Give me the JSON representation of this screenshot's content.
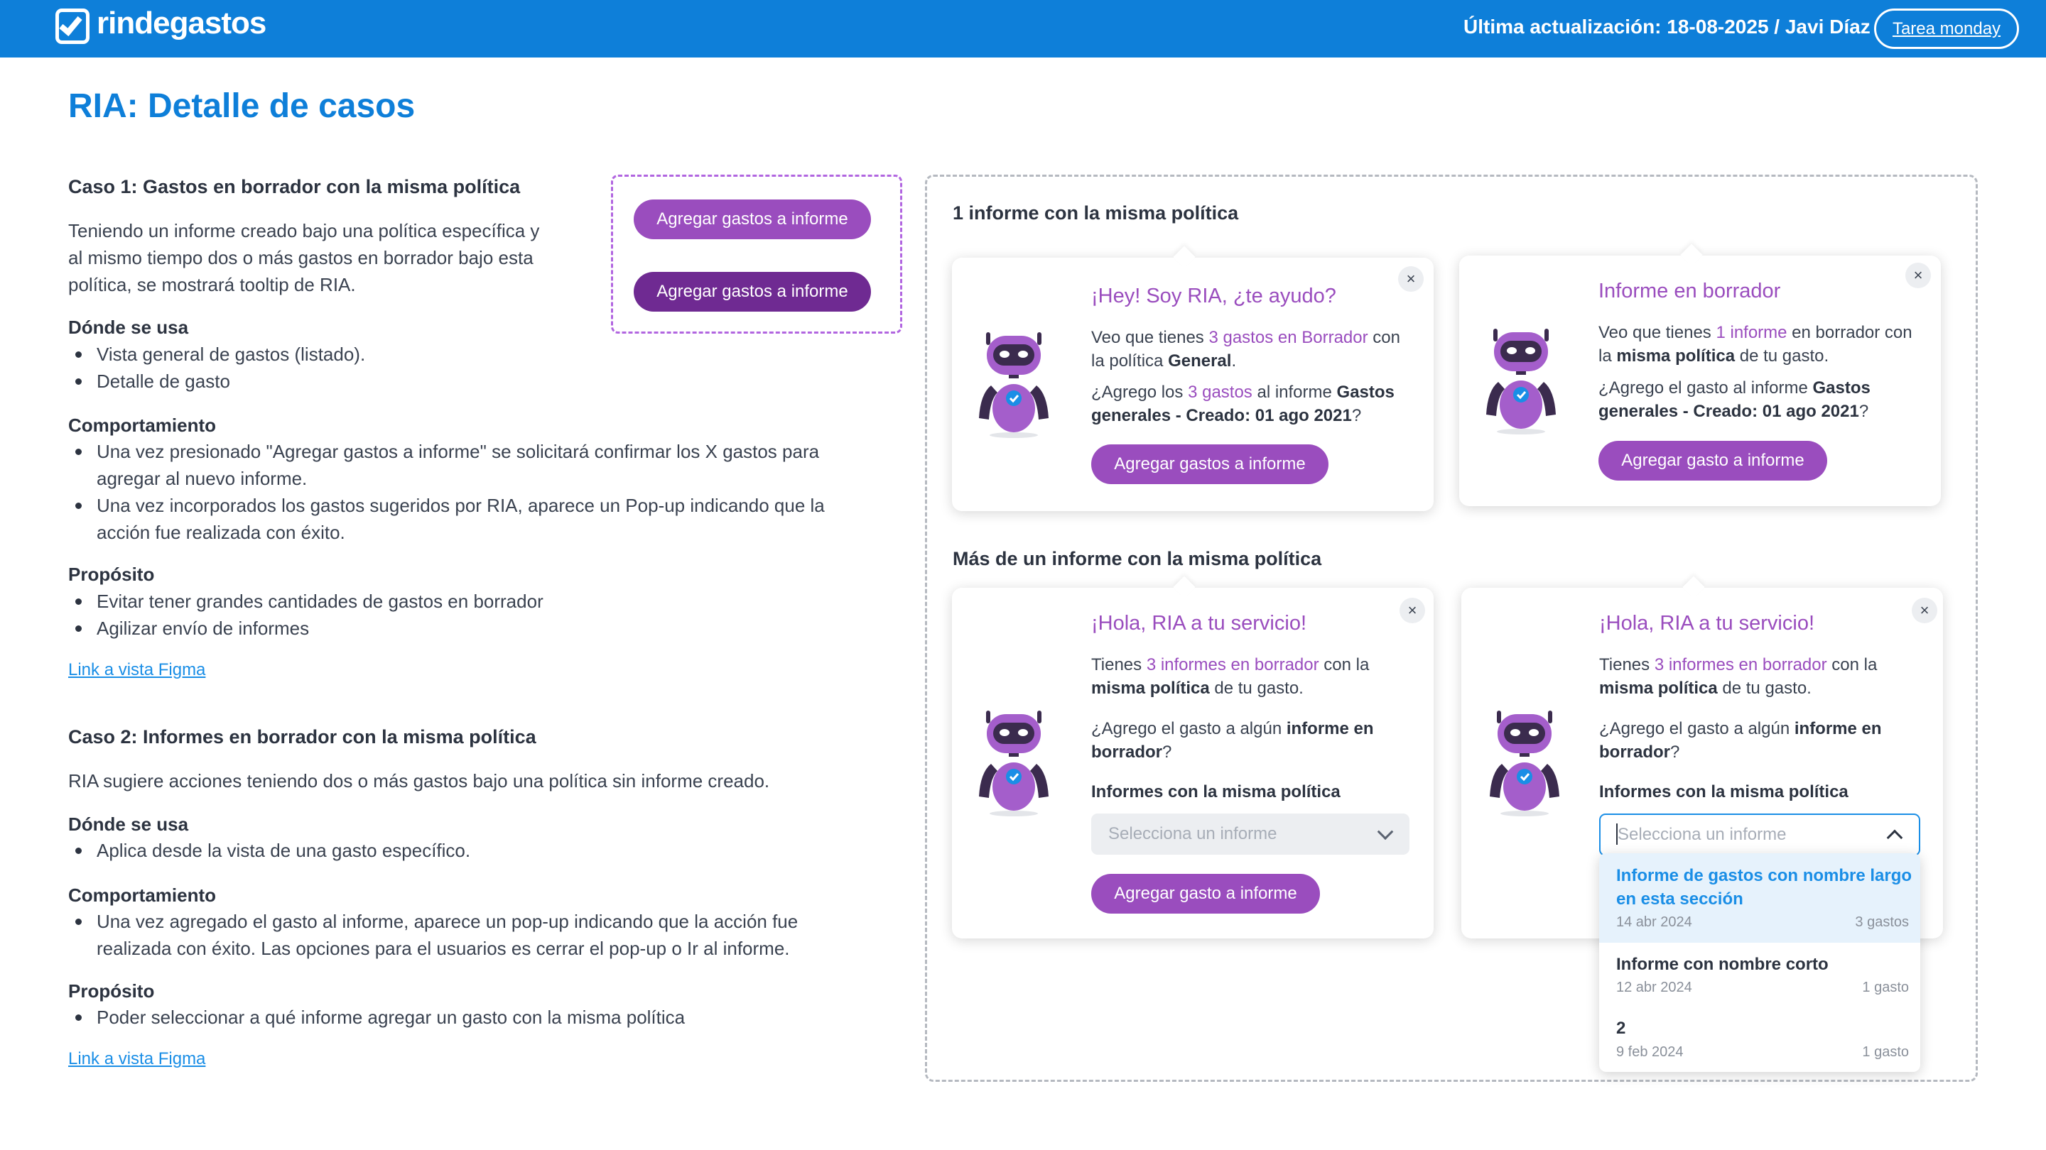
{
  "header": {
    "brand": "rindegastos",
    "updated": "Última actualización: 18-08-2025 / Javi Díaz",
    "tarea_button": "Tarea monday"
  },
  "page_title": "RIA: Detalle de casos",
  "case1": {
    "title": "Caso 1: Gastos en borrador con la misma política",
    "description": "Teniendo un informe creado bajo una política específica y al mismo tiempo dos o más gastos en borrador bajo esta política, se mostrará tooltip de RIA.",
    "donde_heading": "Dónde se usa",
    "donde_items": [
      "Vista general de gastos (listado).",
      "Detalle de gasto"
    ],
    "comportamiento_heading": "Comportamiento",
    "comportamiento_items": [
      "Una vez presionado \"Agregar gastos a informe\" se solicitará confirmar los X gastos para agregar al nuevo informe.",
      "Una vez incorporados los gastos sugeridos por RIA, aparece un Pop-up indicando que la acción fue realizada con éxito."
    ],
    "proposito_heading": "Propósito",
    "proposito_items": [
      "Evitar tener grandes cantidades de gastos en borrador",
      "Agilizar envío de informes"
    ],
    "link": "Link a vista Figma"
  },
  "case2": {
    "title": "Caso 2: Informes en borrador con la misma política",
    "description": "RIA sugiere acciones teniendo dos o más gastos bajo una política sin informe creado.",
    "donde_heading": "Dónde se usa",
    "donde_items": [
      "Aplica desde la vista de una gasto específico."
    ],
    "comportamiento_heading": "Comportamiento",
    "comportamiento_items": [
      "Una vez agregado el gasto al informe, aparece un pop-up indicando que la acción fue realizada con éxito. Las opciones para el usuarios es cerrar el pop-up o Ir al informe."
    ],
    "proposito_heading": "Propósito",
    "proposito_items": [
      "Poder seleccionar a qué informe agregar un gasto con la misma política"
    ],
    "link": "Link a vista Figma"
  },
  "button_demo": {
    "default_label": "Agregar gastos a informe",
    "hover_label": "Agregar gastos a informe"
  },
  "section1_title": "1 informe con la misma política",
  "section2_title": "Más de un informe con la misma política",
  "card1": {
    "title": "¡Hey! Soy RIA, ¿te ayudo?",
    "p1_a": "Veo que tienes ",
    "p1_hl": "3 gastos en Borrador",
    "p1_b": " con la política ",
    "p1_bold": "General",
    "p1_c": ".",
    "p2_a": "¿Agrego los ",
    "p2_hl": "3 gastos",
    "p2_b": " al informe ",
    "p2_bold": "Gastos generales - Creado: 01 ago 2021",
    "p2_c": "?",
    "button": "Agregar gastos a informe",
    "close": "×"
  },
  "card2": {
    "title": "Informe en borrador",
    "p1_a": "Veo que tienes ",
    "p1_hl": "1 informe",
    "p1_b": " en borrador con la ",
    "p1_bold": "misma política",
    "p1_c": " de tu gasto.",
    "p2_a": "¿Agrego el gasto al informe ",
    "p2_bold": "Gastos generales - Creado: 01 ago 2021",
    "p2_c": "?",
    "button": "Agregar gasto a informe",
    "close": "×"
  },
  "card3": {
    "title": "¡Hola, RIA a tu servicio!",
    "p1_a": "Tienes ",
    "p1_hl": "3 informes en borrador",
    "p1_b": " con la ",
    "p1_bold": "misma política",
    "p1_c": " de tu gasto.",
    "p2_a": "¿Agrego el gasto a algún ",
    "p2_bold": "informe en borrador",
    "p2_c": "?",
    "label": "Informes con la misma política",
    "select_placeholder": "Selecciona un informe",
    "button": "Agregar gasto a informe",
    "close": "×"
  },
  "card4": {
    "title": "¡Hola, RIA a tu servicio!",
    "p1_a": "Tienes ",
    "p1_hl": "3 informes en borrador",
    "p1_b": " con la ",
    "p1_bold": "misma política",
    "p1_c": " de tu gasto.",
    "p2_a": "¿Agrego el gasto a algún ",
    "p2_bold": "informe en borrador",
    "p2_c": "?",
    "label": "Informes con la misma política",
    "select_placeholder": "Selecciona un informe",
    "close": "×",
    "options": [
      {
        "name": "Informe de gastos con nombre largo en esta sección",
        "date": "14 abr 2024",
        "count": "3 gastos"
      },
      {
        "name": "Informe con nombre corto",
        "date": "12 abr 2024",
        "count": "1 gasto"
      },
      {
        "name": "2",
        "date": "9 feb 2024",
        "count": "1 gasto"
      }
    ]
  },
  "colors": {
    "brand_blue": "#0e7fd9",
    "ria_purple": "#9a4dbe",
    "ria_purple_dark": "#6f2a92",
    "link_blue": "#1a8ee6"
  }
}
